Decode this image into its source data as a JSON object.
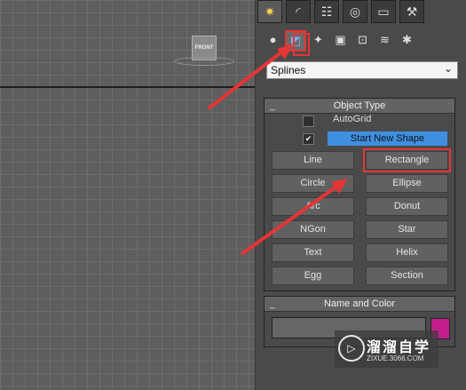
{
  "viewport": {
    "label": "FRONT"
  },
  "tabs": [
    {
      "icon": "create-sun-icon",
      "glyph": "✷"
    },
    {
      "icon": "modify-curve-icon",
      "glyph": "◜"
    },
    {
      "icon": "hierarchy-icon",
      "glyph": "☷"
    },
    {
      "icon": "motion-icon",
      "glyph": "◎"
    },
    {
      "icon": "display-monitor-icon",
      "glyph": "▭"
    },
    {
      "icon": "utilities-hammer-icon",
      "glyph": "⚒"
    }
  ],
  "subcategories": [
    {
      "icon": "geometry-sphere-icon",
      "glyph": "●"
    },
    {
      "icon": "shapes-icon",
      "glyph": "◩"
    },
    {
      "icon": "lights-icon",
      "glyph": "✦"
    },
    {
      "icon": "cameras-icon",
      "glyph": "▣"
    },
    {
      "icon": "helpers-icon",
      "glyph": "⊡"
    },
    {
      "icon": "spacewarps-icon",
      "glyph": "≋"
    },
    {
      "icon": "systems-icon",
      "glyph": "✱"
    }
  ],
  "dropdown": {
    "value": "Splines"
  },
  "object_type": {
    "title": "Object Type",
    "collapse": "_",
    "autogrid": "AutoGrid",
    "start_new_shape": "Start New Shape",
    "start_new_shape_checked": "✔",
    "buttons": [
      "Line",
      "Rectangle",
      "Circle",
      "Ellipse",
      "Arc",
      "Donut",
      "NGon",
      "Star",
      "Text",
      "Helix",
      "Egg",
      "Section"
    ]
  },
  "name_and_color": {
    "title": "Name and Color",
    "collapse": "_",
    "name_value": "",
    "color": "#c21f8d"
  },
  "watermark": {
    "title": "溜溜自学",
    "url": "ZIXUE.3066.COM",
    "logo": "▷"
  },
  "colors": {
    "accent_red": "#e53535",
    "button_blue": "#3f8fe0"
  }
}
